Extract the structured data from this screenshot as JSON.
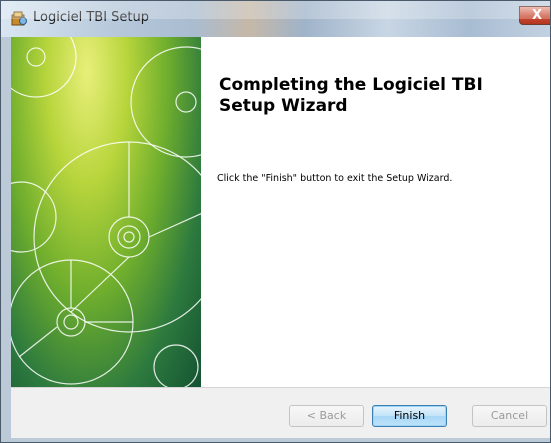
{
  "window": {
    "title": "Logiciel TBI Setup",
    "close_glyph": "X"
  },
  "content": {
    "heading": "Completing the Logiciel TBI Setup Wizard",
    "body": "Click the \"Finish\" button to exit the Setup Wizard."
  },
  "buttons": {
    "back": "< Back",
    "finish": "Finish",
    "cancel": "Cancel"
  },
  "icons": {
    "app": "installer-icon",
    "banner": "cd-discs-banner"
  }
}
